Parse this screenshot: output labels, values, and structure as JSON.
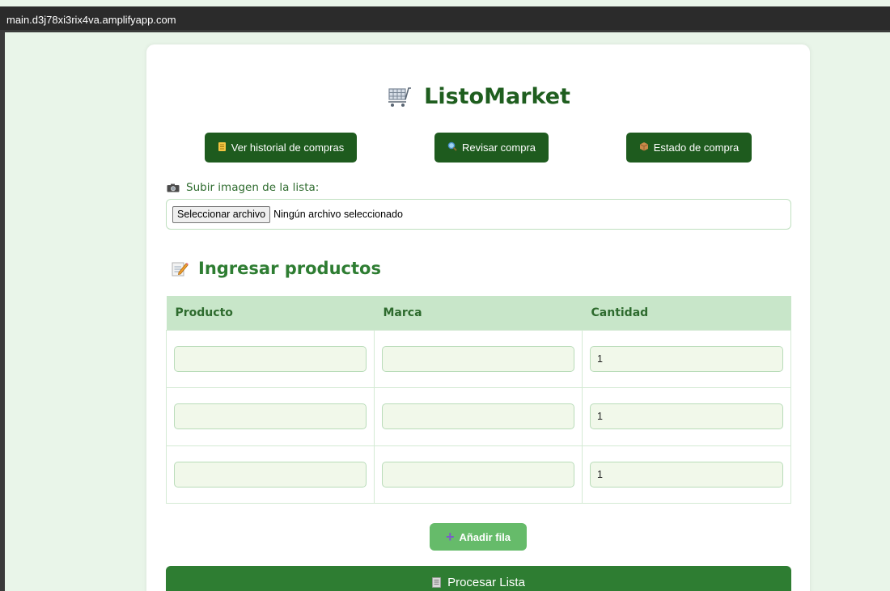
{
  "browser": {
    "url": "main.d3j78xi3rix4va.amplifyapp.com"
  },
  "app": {
    "title": "ListoMarket"
  },
  "nav_buttons": {
    "history": {
      "label": "Ver historial de compras",
      "icon": "scroll-icon"
    },
    "review": {
      "label": "Revisar compra",
      "icon": "magnifier-icon"
    },
    "status": {
      "label": "Estado de compra",
      "icon": "package-icon"
    }
  },
  "upload": {
    "label": "Subir imagen de la lista:",
    "button": "Seleccionar archivo",
    "status": "Ningún archivo seleccionado"
  },
  "products": {
    "title": "Ingresar productos",
    "columns": [
      "Producto",
      "Marca",
      "Cantidad"
    ],
    "rows": [
      {
        "producto": "",
        "marca": "",
        "cantidad": "1"
      },
      {
        "producto": "",
        "marca": "",
        "cantidad": "1"
      },
      {
        "producto": "",
        "marca": "",
        "cantidad": "1"
      }
    ]
  },
  "actions": {
    "add_row": "Añadir fila",
    "process": "Procesar Lista"
  },
  "colors": {
    "page_bg": "#e9f5e9",
    "dark_green": "#1e5b1e",
    "primary_green": "#2e7d32",
    "light_green": "#66bb6a",
    "header_green": "#c8e6c9"
  }
}
